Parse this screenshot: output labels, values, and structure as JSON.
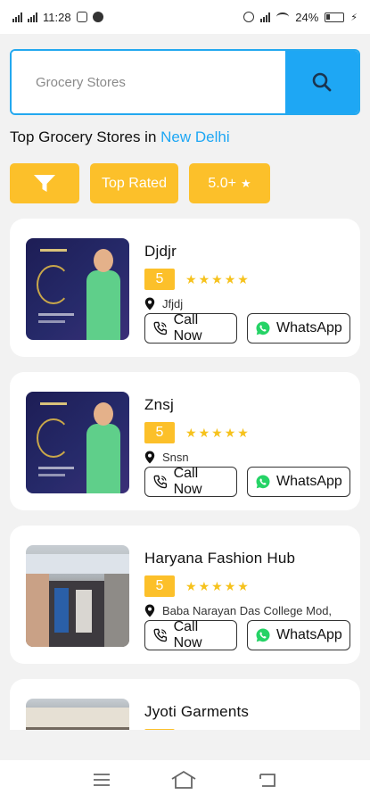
{
  "status_bar": {
    "time": "11:28",
    "battery": "24%"
  },
  "search": {
    "placeholder": "Grocery Stores"
  },
  "heading": {
    "prefix": "Top Grocery Stores in ",
    "city": "New Delhi"
  },
  "filters": {
    "top_rated": "Top Rated",
    "rating_filter": "5.0+"
  },
  "stores": [
    {
      "name": "Djdjr",
      "rating": "5",
      "stars": 5,
      "address": "Jfjdj",
      "call_label": "Call Now",
      "whatsapp_label": "WhatsApp"
    },
    {
      "name": "Znsj",
      "rating": "5",
      "stars": 5,
      "address": "Snsn",
      "call_label": "Call Now",
      "whatsapp_label": "WhatsApp"
    },
    {
      "name": "Haryana Fashion Hub",
      "rating": "5",
      "stars": 5,
      "address": "Baba Narayan Das College Mod,",
      "call_label": "Call Now",
      "whatsapp_label": "WhatsApp"
    },
    {
      "name": "Jyoti Garments"
    }
  ],
  "colors": {
    "accent": "#1ea7f4",
    "chip": "#fcc02a",
    "star": "#f6c21c"
  },
  "icons": {
    "search": "search-icon",
    "filter": "filter-icon",
    "star": "star-icon",
    "location": "location-pin-icon",
    "phone": "phone-icon",
    "whatsapp": "whatsapp-icon",
    "nav_menu": "menu-icon",
    "nav_home": "home-icon",
    "nav_back": "back-icon"
  }
}
